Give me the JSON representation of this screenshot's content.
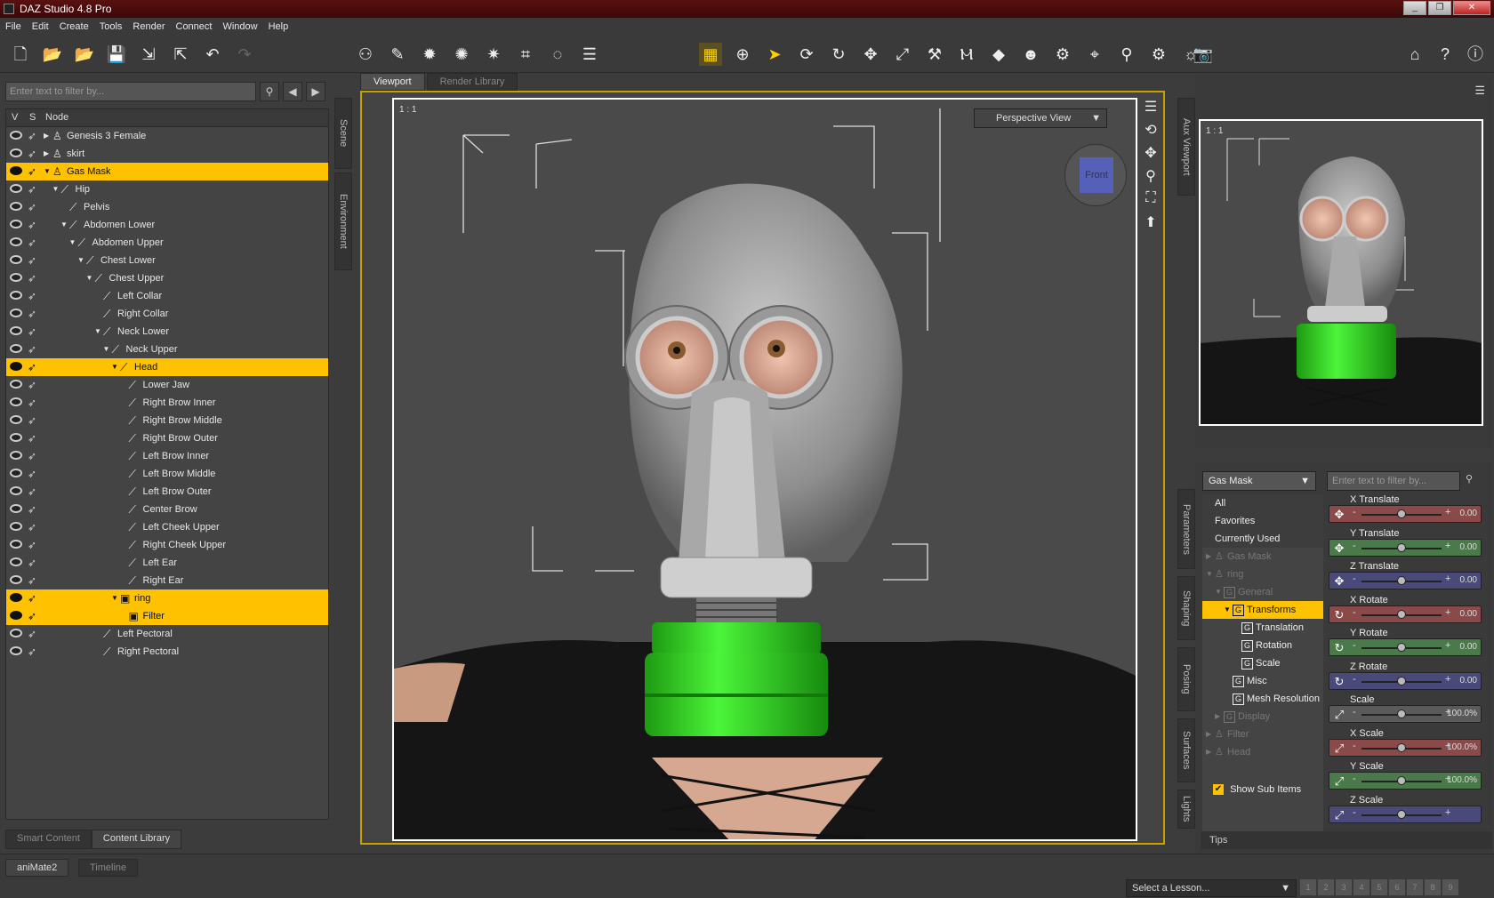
{
  "window": {
    "title": "DAZ Studio 4.8 Pro",
    "buttons": [
      "_",
      "❐",
      "✕"
    ]
  },
  "menu": [
    "File",
    "Edit",
    "Create",
    "Tools",
    "Render",
    "Connect",
    "Window",
    "Help"
  ],
  "toolbar": {
    "file_icons": [
      "new-file-icon",
      "open-icon",
      "merge-icon",
      "save-icon",
      "import-icon",
      "export-icon",
      "undo-icon",
      "redo-icon"
    ],
    "create_icons": [
      "figure-icon",
      "light-icon",
      "spotlight-icon",
      "point-light-icon",
      "distant-light-icon",
      "camera-icon",
      "null-icon",
      "align-icon"
    ],
    "view_icons": [
      "active-pose-icon",
      "universal-tool-icon",
      "select-icon",
      "rotate-tool-icon",
      "orbit-icon",
      "translate-icon",
      "scale-icon",
      "joint-editor-icon",
      "node-weight-icon",
      "geometry-editor-icon",
      "surface-selection-icon",
      "figure-setup-icon",
      "render-camera-icon",
      "pointer-icon",
      "spot-render-icon",
      "render-settings-icon",
      "render-icon"
    ],
    "right_icons": [
      "home-icon",
      "whats-this-icon",
      "help-icon"
    ]
  },
  "scene": {
    "filter_placeholder": "Enter text to filter by...",
    "columns": {
      "v": "V",
      "s": "S",
      "node": "Node"
    },
    "side_tabs": [
      "Scene",
      "Environment"
    ],
    "nodes": [
      {
        "label": "Genesis 3 Female",
        "depth": 0,
        "arrow": "▶",
        "icon": "figure",
        "hl": false
      },
      {
        "label": "skirt",
        "depth": 0,
        "arrow": "▶",
        "icon": "figure",
        "hl": false
      },
      {
        "label": "Gas Mask",
        "depth": 0,
        "arrow": "▼",
        "icon": "figure",
        "hl": true
      },
      {
        "label": "Hip",
        "depth": 1,
        "arrow": "▼",
        "icon": "bone",
        "hl": false
      },
      {
        "label": "Pelvis",
        "depth": 2,
        "arrow": "",
        "icon": "bone",
        "hl": false
      },
      {
        "label": "Abdomen Lower",
        "depth": 2,
        "arrow": "▼",
        "icon": "bone",
        "hl": false
      },
      {
        "label": "Abdomen Upper",
        "depth": 3,
        "arrow": "▼",
        "icon": "bone",
        "hl": false
      },
      {
        "label": "Chest Lower",
        "depth": 4,
        "arrow": "▼",
        "icon": "bone",
        "hl": false
      },
      {
        "label": "Chest Upper",
        "depth": 5,
        "arrow": "▼",
        "icon": "bone",
        "hl": false
      },
      {
        "label": "Left Collar",
        "depth": 6,
        "arrow": "",
        "icon": "bone",
        "hl": false
      },
      {
        "label": "Right Collar",
        "depth": 6,
        "arrow": "",
        "icon": "bone",
        "hl": false
      },
      {
        "label": "Neck Lower",
        "depth": 6,
        "arrow": "▼",
        "icon": "bone",
        "hl": false
      },
      {
        "label": "Neck Upper",
        "depth": 7,
        "arrow": "▼",
        "icon": "bone",
        "hl": false
      },
      {
        "label": "Head",
        "depth": 8,
        "arrow": "▼",
        "icon": "bone",
        "hl": true
      },
      {
        "label": "Lower Jaw",
        "depth": 9,
        "arrow": "",
        "icon": "bone",
        "hl": false
      },
      {
        "label": "Right Brow Inner",
        "depth": 9,
        "arrow": "",
        "icon": "bone",
        "hl": false
      },
      {
        "label": "Right Brow Middle",
        "depth": 9,
        "arrow": "",
        "icon": "bone",
        "hl": false
      },
      {
        "label": "Right Brow Outer",
        "depth": 9,
        "arrow": "",
        "icon": "bone",
        "hl": false
      },
      {
        "label": "Left Brow Inner",
        "depth": 9,
        "arrow": "",
        "icon": "bone",
        "hl": false
      },
      {
        "label": "Left Brow Middle",
        "depth": 9,
        "arrow": "",
        "icon": "bone",
        "hl": false
      },
      {
        "label": "Left Brow Outer",
        "depth": 9,
        "arrow": "",
        "icon": "bone",
        "hl": false
      },
      {
        "label": "Center Brow",
        "depth": 9,
        "arrow": "",
        "icon": "bone",
        "hl": false
      },
      {
        "label": "Left Cheek Upper",
        "depth": 9,
        "arrow": "",
        "icon": "bone",
        "hl": false
      },
      {
        "label": "Right Cheek Upper",
        "depth": 9,
        "arrow": "",
        "icon": "bone",
        "hl": false
      },
      {
        "label": "Left Ear",
        "depth": 9,
        "arrow": "",
        "icon": "bone",
        "hl": false
      },
      {
        "label": "Right Ear",
        "depth": 9,
        "arrow": "",
        "icon": "bone",
        "hl": false
      },
      {
        "label": "ring",
        "depth": 8,
        "arrow": "▼",
        "icon": "prop",
        "hl": true
      },
      {
        "label": "Filter",
        "depth": 9,
        "arrow": "",
        "icon": "prop",
        "hl": true
      },
      {
        "label": "Left Pectoral",
        "depth": 6,
        "arrow": "",
        "icon": "bone",
        "hl": false
      },
      {
        "label": "Right Pectoral",
        "depth": 6,
        "arrow": "",
        "icon": "bone",
        "hl": false
      }
    ],
    "bottom_tabs": [
      "Smart Content",
      "Content Library"
    ]
  },
  "viewport": {
    "tabs": [
      "Viewport",
      "Render Library"
    ],
    "ratio": "1 : 1",
    "camera": "Perspective View",
    "cube_face": "Front"
  },
  "aux": {
    "side_tab": "Aux Viewport",
    "ratio": "1 : 1"
  },
  "params": {
    "node": "Gas Mask",
    "filter_placeholder": "Enter text to filter by...",
    "side_tabs": [
      "Parameters",
      "Shaping",
      "Posing",
      "Surfaces",
      "Lights"
    ],
    "tree": [
      {
        "label": "All",
        "indent": 0,
        "arrow": "",
        "g": false,
        "style": "grp"
      },
      {
        "label": "Favorites",
        "indent": 0,
        "arrow": "",
        "g": false,
        "style": "grp"
      },
      {
        "label": "Currently Used",
        "indent": 0,
        "arrow": "",
        "g": false,
        "style": "grp"
      },
      {
        "label": "Gas Mask",
        "indent": 0,
        "arrow": "▶",
        "g": false,
        "style": "dim"
      },
      {
        "label": "ring",
        "indent": 0,
        "arrow": "▼",
        "g": false,
        "style": "dim"
      },
      {
        "label": "General",
        "indent": 1,
        "arrow": "▼",
        "g": true,
        "style": "dim"
      },
      {
        "label": "Transforms",
        "indent": 2,
        "arrow": "▼",
        "g": true,
        "style": "hl"
      },
      {
        "label": "Translation",
        "indent": 3,
        "arrow": "",
        "g": true,
        "style": ""
      },
      {
        "label": "Rotation",
        "indent": 3,
        "arrow": "",
        "g": true,
        "style": ""
      },
      {
        "label": "Scale",
        "indent": 3,
        "arrow": "",
        "g": true,
        "style": ""
      },
      {
        "label": "Misc",
        "indent": 2,
        "arrow": "",
        "g": true,
        "style": ""
      },
      {
        "label": "Mesh Resolution",
        "indent": 2,
        "arrow": "",
        "g": true,
        "style": ""
      },
      {
        "label": "Display",
        "indent": 1,
        "arrow": "▶",
        "g": true,
        "style": "dim"
      },
      {
        "label": "Filter",
        "indent": 0,
        "arrow": "▶",
        "g": false,
        "style": "dim"
      },
      {
        "label": "Head",
        "indent": 0,
        "arrow": "▶",
        "g": false,
        "style": "dim"
      }
    ],
    "show_sub_items": "Show Sub Items",
    "sliders": [
      {
        "name": "X Translate",
        "value": "0.00",
        "color": "#8a4a4a",
        "icon": "translate",
        "level": 0.5
      },
      {
        "name": "Y Translate",
        "value": "0.00",
        "color": "#4a7a4a",
        "icon": "translate",
        "level": 0.5
      },
      {
        "name": "Z Translate",
        "value": "0.00",
        "color": "#4a4a7a",
        "icon": "translate",
        "level": 0.5
      },
      {
        "name": "X Rotate",
        "value": "0.00",
        "color": "#8a4a4a",
        "icon": "rotate",
        "level": 0.5
      },
      {
        "name": "Y Rotate",
        "value": "0.00",
        "color": "#4a7a4a",
        "icon": "rotate",
        "level": 0.5
      },
      {
        "name": "Z Rotate",
        "value": "0.00",
        "color": "#4a4a7a",
        "icon": "rotate",
        "level": 0.5
      },
      {
        "name": "Scale",
        "value": "100.0%",
        "color": "#5a5a5a",
        "icon": "scale",
        "level": 0.5
      },
      {
        "name": "X Scale",
        "value": "100.0%",
        "color": "#8a4a4a",
        "icon": "scale",
        "level": 0.5
      },
      {
        "name": "Y Scale",
        "value": "100.0%",
        "color": "#4a7a4a",
        "icon": "scale",
        "level": 0.5
      },
      {
        "name": "Z Scale",
        "value": "",
        "color": "#4a4a7a",
        "icon": "scale",
        "level": 0.5
      }
    ],
    "tips": "Tips"
  },
  "status": {
    "tabs": [
      "aniMate2",
      "Timeline"
    ],
    "lesson": "Select a Lesson...",
    "pages": [
      "1",
      "2",
      "3",
      "4",
      "5",
      "6",
      "7",
      "8",
      "9"
    ]
  }
}
